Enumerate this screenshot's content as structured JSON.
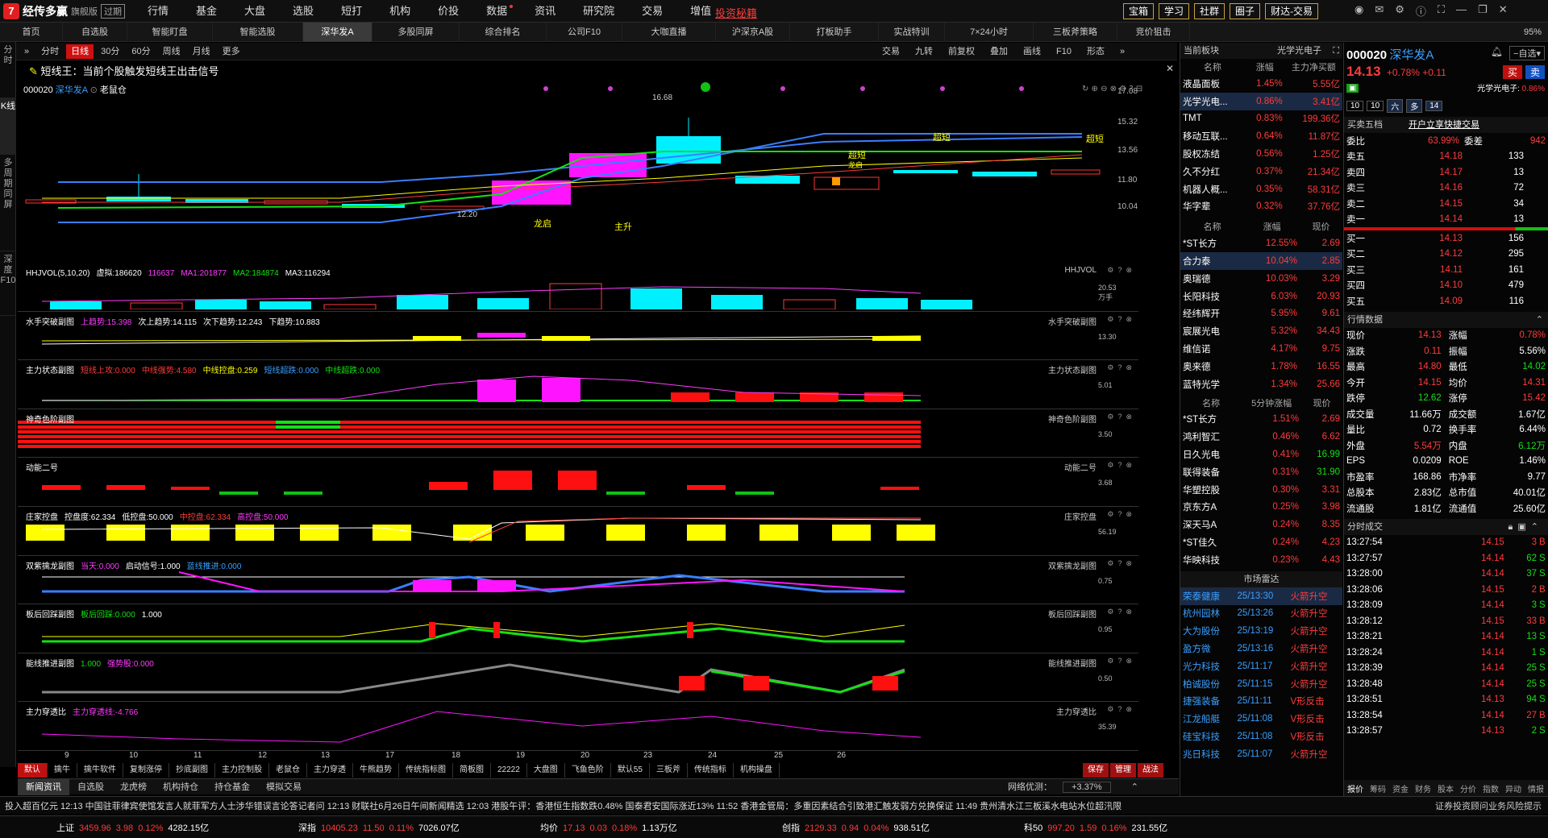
{
  "app": {
    "name": "经传多赢",
    "edition": "旗舰版",
    "expired": "过期",
    "promo": "投资秘籍",
    "menu": [
      "行情",
      "基金",
      "大盘",
      "选股",
      "短打",
      "机构",
      "价投",
      "数据",
      "资讯",
      "研究院",
      "交易",
      "增值"
    ],
    "top_buttons": [
      "宝箱",
      "学习",
      "社群",
      "圈子",
      "财达-交易"
    ]
  },
  "tabs": [
    "首页",
    "自选股",
    "智能盯盘",
    "智能选股",
    "深华发A",
    "多股同屏",
    "综合排名",
    "公司F10",
    "大咖直播",
    "沪深京A股",
    "打板助手",
    "实战特训",
    "7×24小时",
    "三板斧策略",
    "竞价狙击"
  ],
  "zoom": "95%",
  "left_strip": [
    "分时",
    "K线",
    "多周期同屏",
    "深度F10"
  ],
  "toolbar": {
    "left": [
      "分时",
      "日线",
      "30分",
      "60分",
      "周线",
      "月线",
      "更多"
    ],
    "right": [
      "交易",
      "九转",
      "前复权",
      "叠加",
      "画线",
      "F10",
      "形态"
    ]
  },
  "info_banner": "短线王：当前个股触发短线王出击信号",
  "stock": {
    "code": "000020",
    "name": "深华发A",
    "badge": "老鼠仓"
  },
  "main_chart": {
    "y_labels": [
      "17.08",
      "15.32",
      "13.56",
      "11.80",
      "10.04"
    ],
    "high_label": "16.68",
    "low_label": "12.20",
    "annotations": [
      "龙启",
      "主升",
      "超短",
      "超短",
      "超短",
      "龙启"
    ]
  },
  "panes": [
    {
      "title": "HHJVOL(5,10,20)",
      "items": [
        [
          "虚拟:186620",
          "wht"
        ],
        [
          "116637",
          "mag"
        ],
        [
          "MA1:201877",
          "mag"
        ],
        [
          "MA2:184874",
          "green"
        ],
        [
          "MA3:116294",
          "wht"
        ]
      ],
      "rlabel": "HHJVOL",
      "ylabels": [
        "20.53",
        "万手"
      ]
    },
    {
      "title": "水手突破副图",
      "items": [
        [
          "上趋势:15.398",
          "mag"
        ],
        [
          "次上趋势:14.115",
          "wht"
        ],
        [
          "次下趋势:12.243",
          "wht"
        ],
        [
          "下趋势:10.883",
          "wht"
        ]
      ],
      "rlabel": "水手突破副图",
      "ylabels": [
        "13.30"
      ]
    },
    {
      "title": "主力状态副图",
      "items": [
        [
          "短线上攻:0.000",
          "red"
        ],
        [
          "中线强势:4.580",
          "red"
        ],
        [
          "中线控盘:0.259",
          "yel"
        ],
        [
          "短线超跌:0.000",
          "blu"
        ],
        [
          "中线超跌:0.000",
          "green"
        ]
      ],
      "rlabel": "主力状态副图",
      "ylabels": [
        "5.01"
      ]
    },
    {
      "title": "神奇色阶副图",
      "items": [],
      "rlabel": "神奇色阶副图",
      "ylabels": [
        "3.50"
      ]
    },
    {
      "title": "动能二号",
      "items": [],
      "rlabel": "动能二号",
      "ylabels": [
        "3.68"
      ]
    },
    {
      "title": "庄家控盘",
      "items": [
        [
          "控盘度:62.334",
          "wht"
        ],
        [
          "低控盘:50.000",
          "wht"
        ],
        [
          "中控盘:62.334",
          "red"
        ],
        [
          "高控盘:50.000",
          "mag"
        ]
      ],
      "rlabel": "庄家控盘",
      "ylabels": [
        "56.19"
      ]
    },
    {
      "title": "双紫擒龙副图",
      "items": [
        [
          "当天:0.000",
          "mag"
        ],
        [
          "启动信号:1.000",
          "wht"
        ],
        [
          "蓝线推进:0.000",
          "blu"
        ]
      ],
      "rlabel": "双紫擒龙副图",
      "ylabels": [
        "0.75"
      ]
    },
    {
      "title": "板后回踩副图",
      "items": [
        [
          "板后回踩:0.000",
          "green"
        ],
        [
          "1.000",
          "wht"
        ]
      ],
      "rlabel": "板后回踩副图",
      "ylabels": [
        "0.95"
      ]
    },
    {
      "title": "能线推进副图",
      "items": [
        [
          "1.000",
          "green"
        ],
        [
          "强势股:0.000",
          "mag"
        ]
      ],
      "rlabel": "能线推进副图",
      "ylabels": [
        "0.50"
      ]
    },
    {
      "title": "主力穿透比",
      "items": [
        [
          "主力穿透线:-4.766",
          "mag"
        ]
      ],
      "rlabel": "主力穿透比",
      "ylabels": [
        "35.39"
      ]
    }
  ],
  "x_axis": [
    "9",
    "10",
    "11",
    "12",
    "13",
    "17",
    "18",
    "19",
    "20",
    "23",
    "24",
    "25",
    "26"
  ],
  "bottom_tabs": [
    "默认",
    "擒牛",
    "擒牛软件",
    "复制涨停",
    "抄底副图",
    "主力控制股",
    "老鼠仓",
    "主力穿透",
    "牛熊趋势",
    "传统指标图",
    "简板图",
    "22222",
    "大盘图",
    "飞鱼色阶",
    "默认55",
    "三板斧",
    "传统指标",
    "机构操盘"
  ],
  "bottom_actions": [
    "保存",
    "管理",
    "战法"
  ],
  "news_tabs": [
    "新闻资讯",
    "自选股",
    "龙虎榜",
    "机构持仓",
    "持仓基金",
    "模拟交易"
  ],
  "network": "网络优测：",
  "network_val": "+3.37%",
  "ticker": "投入超百亿元    12:13 中国驻菲律宾使馆发言人就菲军方人士涉华错误言论答记者问    12:13 财联社6月26日午间新闻精选    12:03 港股午评：香港恒生指数跌0.48% 国泰君安国际涨近13%    11:52 香港金管局：多重因素结合引致港汇触发弱方兑换保证    11:49 贵州清水江三板溪水电站水位超汛限",
  "ticker_right": "证券投资顾问业务风险提示",
  "status": [
    {
      "name": "上证",
      "vals": [
        "3459.96",
        "3.98",
        "0.12%",
        "4282.15亿"
      ]
    },
    {
      "name": "深指",
      "vals": [
        "10405.23",
        "11.50",
        "0.11%",
        "7026.07亿"
      ]
    },
    {
      "name": "均价",
      "vals": [
        "17.13",
        "0.03",
        "0.18%",
        "1.13万亿"
      ]
    },
    {
      "name": "创指",
      "vals": [
        "2129.33",
        "0.94",
        "0.04%",
        "938.51亿"
      ]
    },
    {
      "name": "科50",
      "vals": [
        "997.20",
        "1.59",
        "0.16%",
        "231.55亿"
      ]
    }
  ],
  "sector": {
    "head": "当前板块",
    "head2": "光学光电子",
    "cols": [
      "名称",
      "涨幅",
      "主力净买额"
    ],
    "rows": [
      [
        "液晶面板",
        "1.45%",
        "5.55亿"
      ],
      [
        "光学光电...",
        "0.86%",
        "3.41亿"
      ],
      [
        "TMT",
        "0.83%",
        "199.36亿"
      ],
      [
        "移动互联...",
        "0.64%",
        "11.87亿"
      ],
      [
        "股权冻结",
        "0.56%",
        "1.25亿"
      ],
      [
        "久不分红",
        "0.37%",
        "21.34亿"
      ],
      [
        "机器人概...",
        "0.35%",
        "58.31亿"
      ],
      [
        "华字辈",
        "0.32%",
        "37.76亿"
      ]
    ],
    "cols2": [
      "名称",
      "涨幅",
      "现价"
    ],
    "rows2": [
      [
        "*ST长方",
        "12.55%",
        "2.69"
      ],
      [
        "合力泰",
        "10.04%",
        "2.85"
      ],
      [
        "奥瑞德",
        "10.03%",
        "3.29"
      ],
      [
        "长阳科技",
        "6.03%",
        "20.93"
      ],
      [
        "经纬辉开",
        "5.95%",
        "9.61"
      ],
      [
        "宸展光电",
        "5.32%",
        "34.43"
      ],
      [
        "维信诺",
        "4.17%",
        "9.75"
      ],
      [
        "奥来德",
        "1.78%",
        "16.55"
      ],
      [
        "蓝特光学",
        "1.34%",
        "25.66"
      ]
    ],
    "cols3": [
      "名称",
      "5分钟涨幅",
      "现价"
    ],
    "rows3": [
      [
        "*ST长方",
        "1.51%",
        "2.69"
      ],
      [
        "鸿利智汇",
        "0.46%",
        "6.62"
      ],
      [
        "日久光电",
        "0.41%",
        "16.99"
      ],
      [
        "联得装备",
        "0.31%",
        "31.90"
      ],
      [
        "华塑控股",
        "0.30%",
        "3.31"
      ],
      [
        "京东方A",
        "0.25%",
        "3.98"
      ],
      [
        "深天马A",
        "0.24%",
        "8.35"
      ],
      [
        "*ST佳久",
        "0.24%",
        "4.23"
      ],
      [
        "华映科技",
        "0.23%",
        "4.43"
      ]
    ],
    "radar_title": "市场雷达",
    "radar": [
      [
        "荣泰健康",
        "25/13:30",
        "火箭升空"
      ],
      [
        "杭州园林",
        "25/13:26",
        "火箭升空"
      ],
      [
        "大为股份",
        "25/13:19",
        "火箭升空"
      ],
      [
        "盈方微",
        "25/13:16",
        "火箭升空"
      ],
      [
        "光力科技",
        "25/11:17",
        "火箭升空"
      ],
      [
        "柏诚股份",
        "25/11:15",
        "火箭升空"
      ],
      [
        "捷强装备",
        "25/11:11",
        "V形反击"
      ],
      [
        "江龙船艇",
        "25/11:08",
        "V形反击"
      ],
      [
        "硅宝科技",
        "25/11:08",
        "V形反击"
      ],
      [
        "兆日科技",
        "25/11:07",
        "火箭升空"
      ]
    ]
  },
  "quote": {
    "code": "000020",
    "name": "深华发A",
    "watch": "自选",
    "price": "14.13",
    "pct": "+0.78%",
    "chg": "+0.11",
    "buy": "买",
    "sell": "卖",
    "sector_label": "光学光电子:",
    "sector_pct": "0.86%",
    "tags": [
      "10",
      "10",
      "六",
      "多",
      "14"
    ],
    "book_title": "买卖五档",
    "book_link": "开户立享快捷交易",
    "weibi": [
      "委比",
      "63.99%",
      "委差",
      "942"
    ],
    "asks": [
      [
        "卖五",
        "14.18",
        "133"
      ],
      [
        "卖四",
        "14.17",
        "13"
      ],
      [
        "卖三",
        "14.16",
        "72"
      ],
      [
        "卖二",
        "14.15",
        "34"
      ],
      [
        "卖一",
        "14.14",
        "13"
      ]
    ],
    "bids": [
      [
        "买一",
        "14.13",
        "156"
      ],
      [
        "买二",
        "14.12",
        "295"
      ],
      [
        "买三",
        "14.11",
        "161"
      ],
      [
        "买四",
        "14.10",
        "479"
      ],
      [
        "买五",
        "14.09",
        "116"
      ]
    ],
    "stats_title": "行情数据",
    "stats": [
      [
        "现价",
        "14.13",
        "涨幅",
        "0.78%"
      ],
      [
        "涨跌",
        "0.11",
        "振幅",
        "5.56%"
      ],
      [
        "最高",
        "14.80",
        "最低",
        "14.02"
      ],
      [
        "今开",
        "14.15",
        "均价",
        "14.31"
      ],
      [
        "跌停",
        "12.62",
        "涨停",
        "15.42"
      ],
      [
        "成交量",
        "11.66万",
        "成交额",
        "1.67亿"
      ],
      [
        "量比",
        "0.72",
        "换手率",
        "6.44%"
      ],
      [
        "外盘",
        "5.54万",
        "内盘",
        "6.12万"
      ],
      [
        "EPS",
        "0.0209",
        "ROE",
        "1.46%"
      ],
      [
        "市盈率",
        "168.86",
        "市净率",
        "9.77"
      ],
      [
        "总股本",
        "2.83亿",
        "总市值",
        "40.01亿"
      ],
      [
        "流通股",
        "1.81亿",
        "流通值",
        "25.60亿"
      ]
    ],
    "ticks_title": "分时成交",
    "ticks": [
      [
        "13:27:54",
        "14.15",
        "3",
        "B"
      ],
      [
        "13:27:57",
        "14.14",
        "62",
        "S"
      ],
      [
        "13:28:00",
        "14.14",
        "37",
        "S"
      ],
      [
        "13:28:06",
        "14.15",
        "2",
        "B"
      ],
      [
        "13:28:09",
        "14.14",
        "3",
        "S"
      ],
      [
        "13:28:12",
        "14.15",
        "33",
        "B"
      ],
      [
        "13:28:21",
        "14.14",
        "13",
        "S"
      ],
      [
        "13:28:24",
        "14.14",
        "1",
        "S"
      ],
      [
        "13:28:39",
        "14.14",
        "25",
        "S"
      ],
      [
        "13:28:48",
        "14.14",
        "25",
        "S"
      ],
      [
        "13:28:51",
        "14.13",
        "94",
        "S"
      ],
      [
        "13:28:54",
        "14.14",
        "27",
        "B"
      ],
      [
        "13:28:57",
        "14.13",
        "2",
        "S"
      ]
    ],
    "bottom_tabs": [
      "报价",
      "筹码",
      "资金",
      "财务",
      "股本",
      "分价",
      "指数",
      "异动",
      "情报"
    ]
  }
}
